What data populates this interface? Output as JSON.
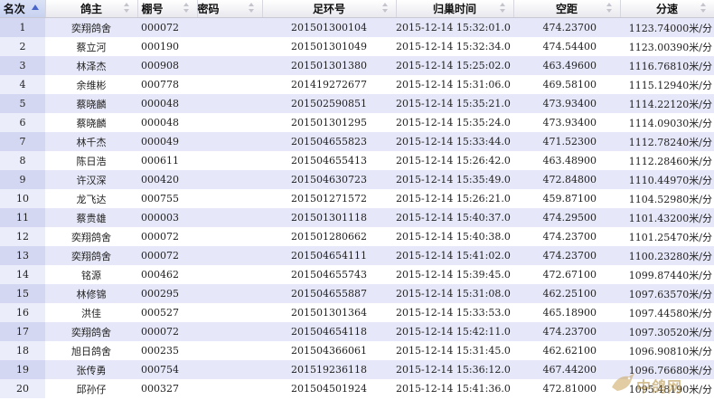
{
  "table": {
    "headers": {
      "rank": "名次",
      "owner": "鸽主",
      "pigeon_no": "棚号",
      "password": "密码",
      "ring": "足环号",
      "return_time": "归巢时间",
      "distance": "空距",
      "speed": "分速"
    },
    "sort": {
      "column": "rank",
      "direction": "ascending"
    },
    "rows": [
      {
        "rank": "1",
        "owner": "奕翔鸽舍",
        "pigeon_no": "000072",
        "password": "",
        "ring": "201501300104",
        "return_time": "2015-12-14 15:32:01.0",
        "distance": "474.23700",
        "speed": "1123.74000米/分"
      },
      {
        "rank": "2",
        "owner": "蔡立河",
        "pigeon_no": "000190",
        "password": "",
        "ring": "201501301049",
        "return_time": "2015-12-14 15:32:34.0",
        "distance": "474.54400",
        "speed": "1123.00390米/分"
      },
      {
        "rank": "3",
        "owner": "林泽杰",
        "pigeon_no": "000908",
        "password": "",
        "ring": "201501301380",
        "return_time": "2015-12-14 15:25:02.0",
        "distance": "463.49600",
        "speed": "1116.76810米/分"
      },
      {
        "rank": "4",
        "owner": "余维彬",
        "pigeon_no": "000778",
        "password": "",
        "ring": "201419272677",
        "return_time": "2015-12-14 15:31:06.0",
        "distance": "469.58100",
        "speed": "1115.12940米/分"
      },
      {
        "rank": "5",
        "owner": "蔡晓麟",
        "pigeon_no": "000048",
        "password": "",
        "ring": "201502590851",
        "return_time": "2015-12-14 15:35:21.0",
        "distance": "473.93400",
        "speed": "1114.22120米/分"
      },
      {
        "rank": "6",
        "owner": "蔡晓麟",
        "pigeon_no": "000048",
        "password": "",
        "ring": "201501301295",
        "return_time": "2015-12-14 15:35:24.0",
        "distance": "473.93400",
        "speed": "1114.09030米/分"
      },
      {
        "rank": "7",
        "owner": "林千杰",
        "pigeon_no": "000049",
        "password": "",
        "ring": "201504655823",
        "return_time": "2015-12-14 15:33:44.0",
        "distance": "471.52300",
        "speed": "1112.78240米/分"
      },
      {
        "rank": "8",
        "owner": "陈日浩",
        "pigeon_no": "000611",
        "password": "",
        "ring": "201504655413",
        "return_time": "2015-12-14 15:26:42.0",
        "distance": "463.48900",
        "speed": "1112.28460米/分"
      },
      {
        "rank": "9",
        "owner": "许汉深",
        "pigeon_no": "000420",
        "password": "",
        "ring": "201504630723",
        "return_time": "2015-12-14 15:35:49.0",
        "distance": "472.84800",
        "speed": "1110.44970米/分"
      },
      {
        "rank": "10",
        "owner": "龙飞达",
        "pigeon_no": "000755",
        "password": "",
        "ring": "201501271572",
        "return_time": "2015-12-14 15:26:21.0",
        "distance": "459.87100",
        "speed": "1104.52980米/分"
      },
      {
        "rank": "11",
        "owner": "蔡贵雄",
        "pigeon_no": "000003",
        "password": "",
        "ring": "201501301118",
        "return_time": "2015-12-14 15:40:37.0",
        "distance": "474.29500",
        "speed": "1101.43200米/分"
      },
      {
        "rank": "12",
        "owner": "奕翔鸽舍",
        "pigeon_no": "000072",
        "password": "",
        "ring": "201501280662",
        "return_time": "2015-12-14 15:40:38.0",
        "distance": "474.23700",
        "speed": "1101.25470米/分"
      },
      {
        "rank": "13",
        "owner": "奕翔鸽舍",
        "pigeon_no": "000072",
        "password": "",
        "ring": "201504654111",
        "return_time": "2015-12-14 15:41:02.0",
        "distance": "474.23700",
        "speed": "1100.23280米/分"
      },
      {
        "rank": "14",
        "owner": "铭源",
        "pigeon_no": "000462",
        "password": "",
        "ring": "201504655743",
        "return_time": "2015-12-14 15:39:45.0",
        "distance": "472.67100",
        "speed": "1099.87440米/分"
      },
      {
        "rank": "15",
        "owner": "林修锦",
        "pigeon_no": "000295",
        "password": "",
        "ring": "201504655887",
        "return_time": "2015-12-14 15:31:08.0",
        "distance": "462.25100",
        "speed": "1097.63570米/分"
      },
      {
        "rank": "16",
        "owner": "洪佳",
        "pigeon_no": "000527",
        "password": "",
        "ring": "201501301364",
        "return_time": "2015-12-14 15:33:53.0",
        "distance": "465.18900",
        "speed": "1097.44580米/分"
      },
      {
        "rank": "17",
        "owner": "奕翔鸽舍",
        "pigeon_no": "000072",
        "password": "",
        "ring": "201504654118",
        "return_time": "2015-12-14 15:42:11.0",
        "distance": "474.23700",
        "speed": "1097.30520米/分"
      },
      {
        "rank": "18",
        "owner": "旭日鸽舍",
        "pigeon_no": "000235",
        "password": "",
        "ring": "201504366061",
        "return_time": "2015-12-14 15:31:45.0",
        "distance": "462.62100",
        "speed": "1096.90810米/分"
      },
      {
        "rank": "19",
        "owner": "张传勇",
        "pigeon_no": "000754",
        "password": "",
        "ring": "201519236118",
        "return_time": "2015-12-14 15:36:12.0",
        "distance": "467.44200",
        "speed": "1096.76680米/分"
      },
      {
        "rank": "20",
        "owner": "邱孙仔",
        "pigeon_no": "000327",
        "password": "",
        "ring": "201504501924",
        "return_time": "2015-12-14 15:41:36.0",
        "distance": "472.81000",
        "speed": "1095.48190米/分"
      }
    ]
  },
  "colors": {
    "row_odd": "#e6e8f9",
    "row_even": "#ffffff",
    "header_bg": "#eceef2",
    "sort_active": "#4a66c8"
  },
  "watermark": {
    "icon": "pigeon-logo-icon",
    "text": "中鸽网"
  }
}
